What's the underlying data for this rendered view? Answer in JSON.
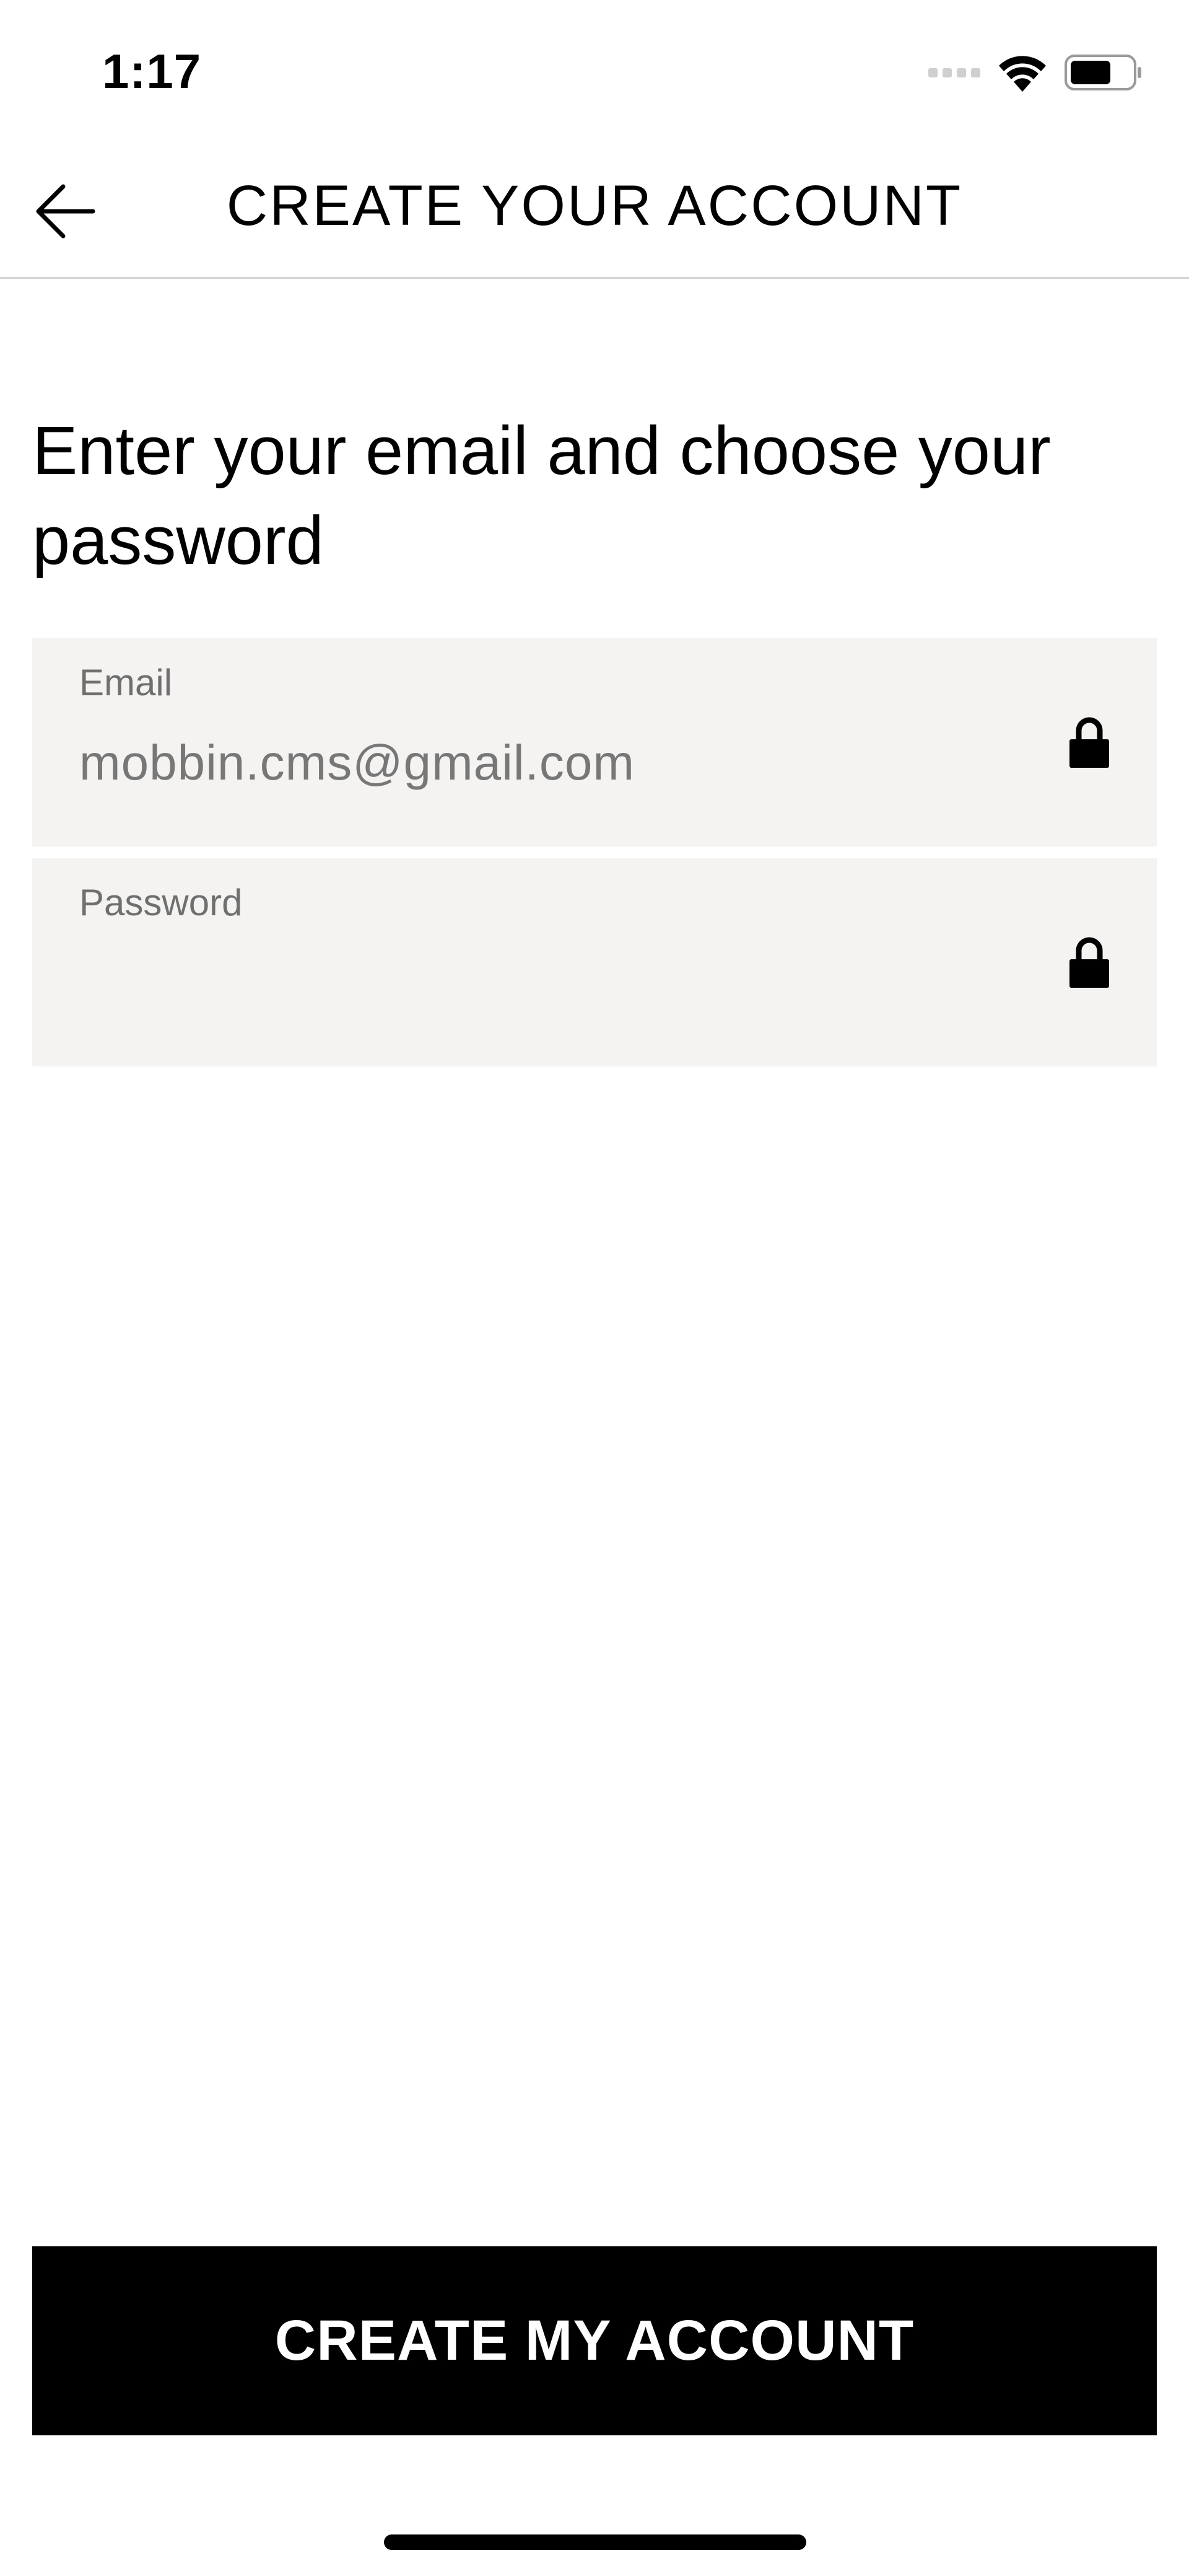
{
  "status_bar": {
    "time": "1:17",
    "icons": [
      "cellular-signal-icon",
      "wifi-icon",
      "battery-icon"
    ]
  },
  "nav": {
    "back_icon": "arrow-left-icon",
    "title": "CREATE YOUR ACCOUNT"
  },
  "heading": "Enter your email and choose your password",
  "form": {
    "email": {
      "label": "Email",
      "value": "mobbin.cms@gmail.com",
      "icon": "lock-icon"
    },
    "password": {
      "label": "Password",
      "value": "",
      "icon": "lock-icon"
    }
  },
  "submit_label": "CREATE MY ACCOUNT",
  "colors": {
    "field_background": "#f4f3f2",
    "button_background": "#000000",
    "button_text": "#ffffff",
    "label_text": "#6f6f6f"
  }
}
